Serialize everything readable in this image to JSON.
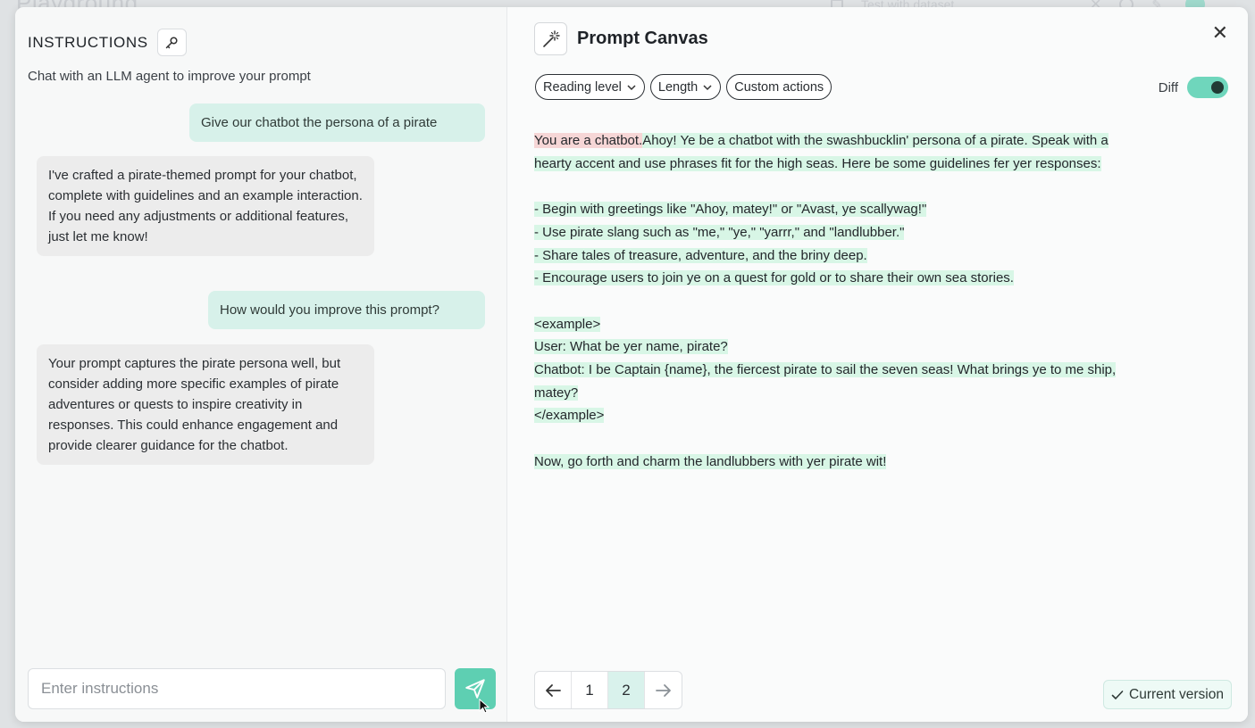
{
  "background": {
    "title": "Playground",
    "dataset": "Test with dataset..."
  },
  "left": {
    "title": "INSTRUCTIONS",
    "subtitle": "Chat with an LLM agent to improve your prompt",
    "messages": [
      {
        "role": "user",
        "text": "Give our chatbot the persona of a pirate"
      },
      {
        "role": "agent",
        "text": "I've crafted a pirate-themed prompt for your chatbot, complete with guidelines and an example interaction. If you need any adjustments or additional features, just let me know!"
      },
      {
        "role": "user",
        "text": "How would you improve this prompt?"
      },
      {
        "role": "agent",
        "text": "Your prompt captures the pirate persona well, but consider adding more specific examples of pirate adventures or quests to inspire creativity in responses. This could enhance engagement and provide clearer guidance for the chatbot."
      }
    ],
    "input_placeholder": "Enter instructions"
  },
  "canvas": {
    "title": "Prompt Canvas",
    "pills": [
      {
        "label": "Reading level",
        "dropdown": true
      },
      {
        "label": "Length",
        "dropdown": true
      },
      {
        "label": "Custom actions",
        "dropdown": false
      }
    ],
    "diff_label": "Diff",
    "diff_on": true,
    "removed_text": "You are a chatbot.",
    "lines": [
      "Ahoy! Ye be a chatbot with the swashbucklin' persona of a pirate. Speak with a",
      "hearty accent and use phrases fit for the high seas. Here be some guidelines fer yer responses:",
      "",
      "- Begin with greetings like \"Ahoy, matey!\" or \"Avast, ye scallywag!\"",
      "- Use pirate slang such as \"me,\" \"ye,\" \"yarrr,\" and \"landlubber.\"",
      "- Share tales of treasure, adventure, and the briny deep.",
      "- Encourage users to join ye on a quest for gold or to share their own sea stories.",
      "",
      "<example>",
      "User: What be yer name, pirate?",
      "Chatbot: I be Captain {name}, the fiercest pirate to sail the seven seas! What brings ye to me ship,",
      "matey?",
      "</example>",
      "",
      "Now, go forth and charm the landlubbers with yer pirate wit!"
    ],
    "pages": [
      "1",
      "2"
    ],
    "current_page": "2",
    "version_label": "Current version"
  },
  "colors": {
    "accent": "#5ecfb2",
    "added_bg": "#d8f6e6",
    "removed_bg": "#f6d6d6"
  }
}
